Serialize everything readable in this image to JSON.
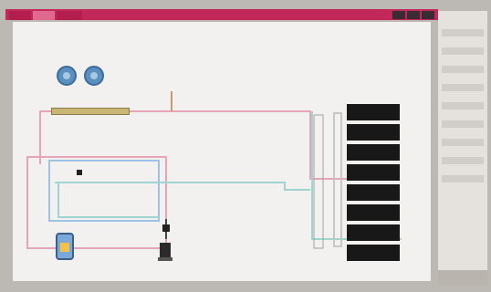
{
  "window": {
    "tabs": [
      "",
      "",
      ""
    ]
  },
  "diagram": {
    "title": "",
    "left_label": "",
    "right_label": ""
  },
  "panel": {
    "rows": [
      "",
      "",
      "",
      "",
      "",
      "",
      "",
      ""
    ]
  },
  "colors": {
    "titlebar": "#c2285a",
    "pipe_pink": "#e6a5b6",
    "pipe_teal": "#9fd5d1",
    "pipe_blue": "#9cc3e6",
    "pipe_tan": "#c79c6c",
    "fan_blue": "#5a8fc0",
    "panel_black": "#181818"
  },
  "icons": {
    "fan": "fan-icon",
    "pump": "pump-icon",
    "tank": "tank-icon",
    "window_controls": "window-controls-icon"
  }
}
